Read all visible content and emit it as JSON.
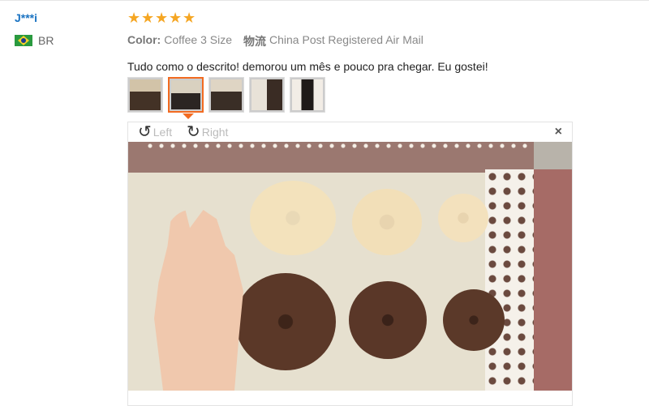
{
  "reviewer": {
    "name": "J***i",
    "country_code": "BR"
  },
  "review": {
    "rating_stars": 5,
    "color_label": "Color:",
    "color_value": "Coffee 3 Size",
    "shipping_label": "物流",
    "shipping_value": "China Post Registered Air Mail",
    "text": "Tudo como o descrito! demorou um mês e pouco pra chegar. Eu gostei!"
  },
  "viewer": {
    "rotate_left_label": "Left",
    "rotate_right_label": "Right",
    "close_icon": "×"
  },
  "thumbnails": [
    "photo-1",
    "photo-2",
    "photo-3",
    "photo-4",
    "photo-5"
  ],
  "active_thumbnail": 2,
  "colors": {
    "star": "#f5a623",
    "accent": "#f26b21",
    "link": "#1a73c2"
  }
}
